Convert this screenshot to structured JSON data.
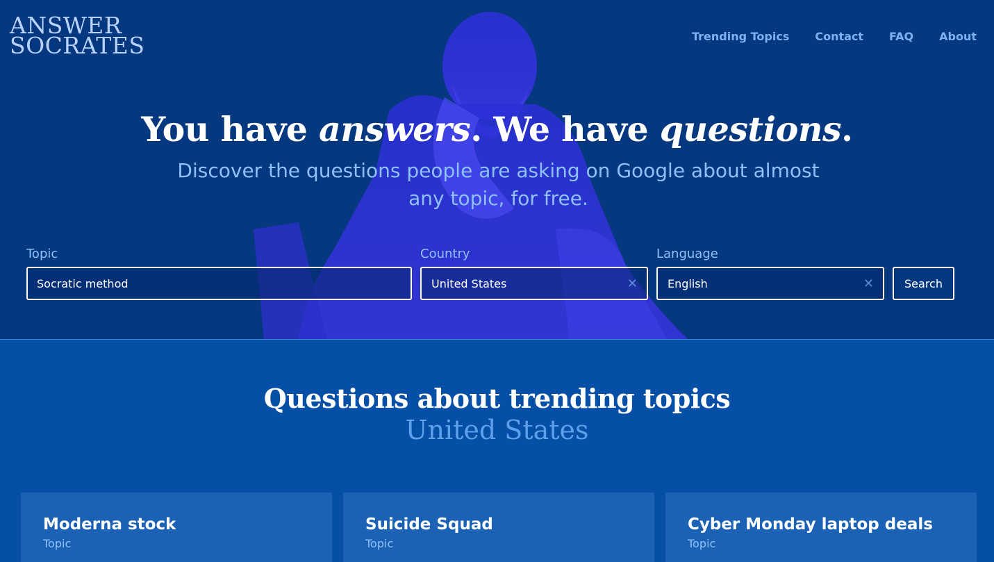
{
  "logo": {
    "line1": "ANSWER",
    "line2": "SOCRATES"
  },
  "nav": [
    "Trending Topics",
    "Contact",
    "FAQ",
    "About"
  ],
  "hero": {
    "headline_1": "You have ",
    "headline_2": "answers",
    "headline_3": ". We have ",
    "headline_4": "questions",
    "headline_5": ".",
    "subhead": "Discover the questions people are asking on Google about almost any topic, for free."
  },
  "form": {
    "topic_label": "Topic",
    "topic_value": "Socratic method",
    "country_label": "Country",
    "country_value": "United States",
    "language_label": "Language",
    "language_value": "English",
    "search_label": "Search"
  },
  "trending": {
    "title": "Questions about trending topics",
    "country": "United States",
    "cards": [
      {
        "title": "Moderna stock",
        "type": "Topic"
      },
      {
        "title": "Suicide Squad",
        "type": "Topic"
      },
      {
        "title": "Cyber Monday laptop deals",
        "type": "Topic"
      }
    ]
  },
  "colors": {
    "hero_bg": "#063880",
    "page_bg": "#0550a6",
    "card_bg": "#1b62b4",
    "accent_text": "#8ec1fa"
  },
  "icons": {
    "clear": "close-icon",
    "statue": "socrates-statue"
  }
}
